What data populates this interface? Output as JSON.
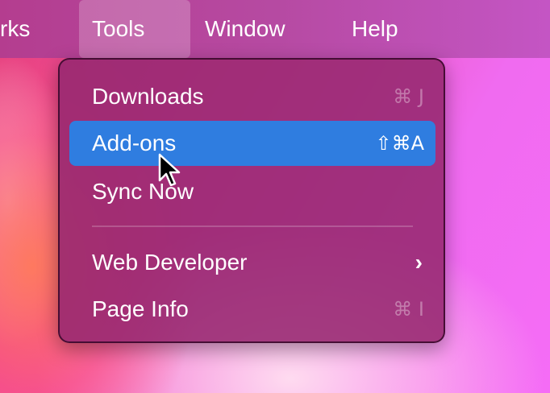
{
  "menubar": {
    "items": [
      {
        "label": "rks"
      },
      {
        "label": "Tools"
      },
      {
        "label": "Window"
      },
      {
        "label": "Help"
      }
    ]
  },
  "tools_menu": {
    "items": [
      {
        "label": "Downloads",
        "shortcut": "⌘ J"
      },
      {
        "label": "Add-ons",
        "shortcut": "⇧⌘A"
      },
      {
        "label": "Sync Now",
        "shortcut": ""
      },
      {
        "label": "Web Developer",
        "submenu_indicator": "chevron-right-icon"
      },
      {
        "label": "Page Info",
        "shortcut": "⌘ I"
      }
    ],
    "highlighted_index": 1
  },
  "colors": {
    "menubar": "#b64aa2",
    "menu_background": "#962870",
    "highlight": "#2f7de0",
    "text": "#ffffff"
  }
}
